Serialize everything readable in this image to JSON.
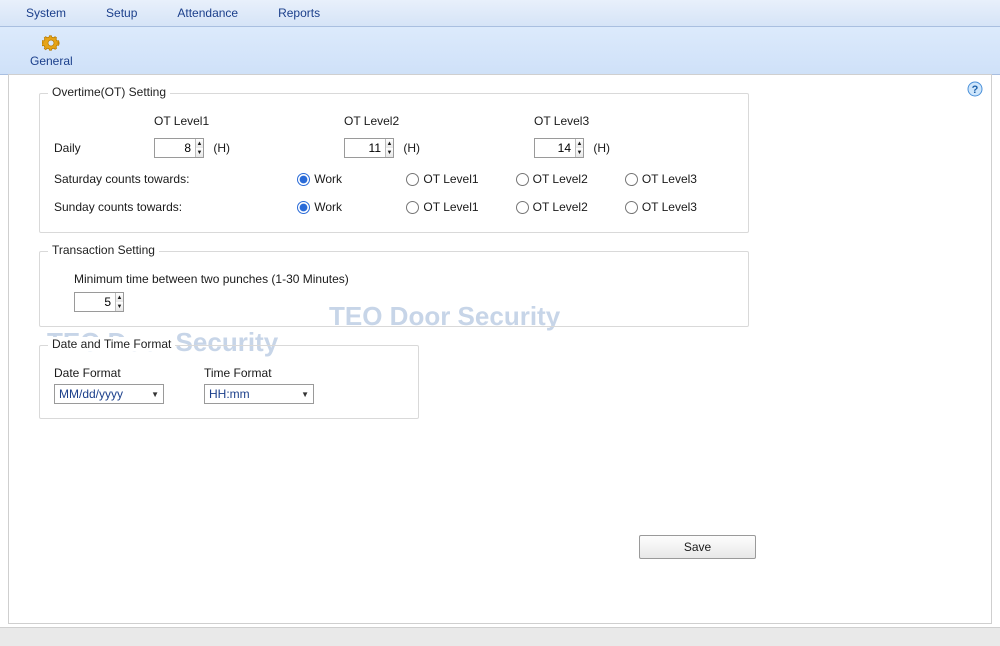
{
  "menu": {
    "items": [
      "System",
      "Setup",
      "Attendance",
      "Reports"
    ]
  },
  "toolbar": {
    "general": "General"
  },
  "overtime": {
    "legend": "Overtime(OT) Setting",
    "col1": "OT Level1",
    "col2": "OT Level2",
    "col3": "OT Level3",
    "daily_label": "Daily",
    "daily_v1": "8",
    "daily_v2": "11",
    "daily_v3": "14",
    "unit": "(H)",
    "sat_label": "Saturday counts towards:",
    "sun_label": "Sunday counts towards:",
    "opt_work": "Work",
    "opt_l1": "OT Level1",
    "opt_l2": "OT Level2",
    "opt_l3": "OT Level3"
  },
  "transaction": {
    "legend": "Transaction Setting",
    "label": "Minimum time between two punches (1-30 Minutes)",
    "value": "5"
  },
  "datetime": {
    "legend": "Date and Time Format",
    "date_label": "Date Format",
    "time_label": "Time Format",
    "date_value": "MM/dd/yyyy",
    "time_value": "HH:mm"
  },
  "buttons": {
    "save": "Save"
  },
  "watermark": "TEO Door Security"
}
